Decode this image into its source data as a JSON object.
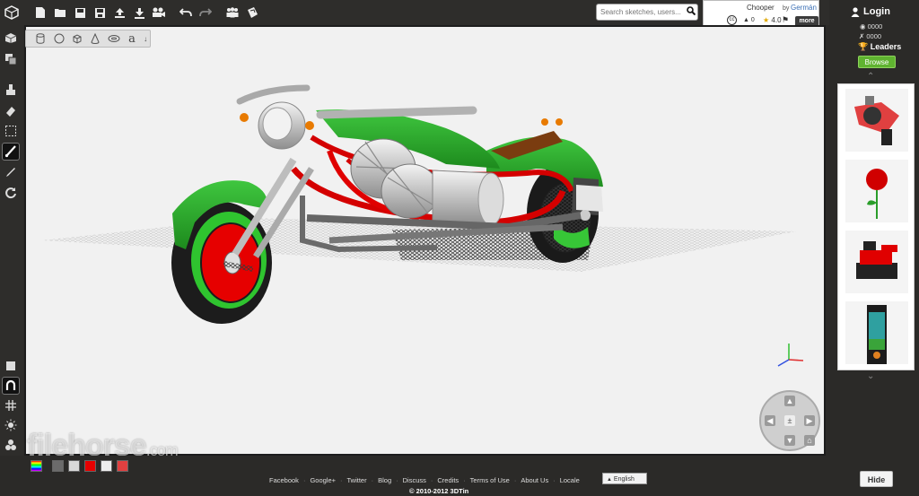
{
  "toolbar": {
    "icons": [
      "new-icon",
      "open-icon",
      "save-icon",
      "save-as-icon",
      "upload-icon",
      "download-icon",
      "camera-icon",
      "undo-icon",
      "redo-icon",
      "community-icon",
      "share-icon"
    ]
  },
  "search": {
    "placeholder": "Search sketches, users..."
  },
  "model_info": {
    "title": "Chooper",
    "by": "by",
    "author": "Germán",
    "cc_label": "cc",
    "stats": "0",
    "rating": "4.0",
    "more_label": "more"
  },
  "shape_tools": [
    "cylinder",
    "sphere",
    "cube",
    "cone",
    "torus",
    "text"
  ],
  "text_tool_glyph": "a",
  "left_tools": [
    "view-cube-icon",
    "box-group-icon",
    "paint-bucket-icon",
    "eraser-icon",
    "select-rect-icon",
    "brush-icon",
    "eyedropper-icon",
    "rotate-icon"
  ],
  "left_tools_bottom": [
    "cube-solid-icon",
    "magnet-icon",
    "grid-icon",
    "sun-icon",
    "settings-icon"
  ],
  "user": {
    "login_label": "Login",
    "count1": "0000",
    "count2": "0000",
    "leaders_label": "Leaders",
    "browse_label": "Browse"
  },
  "gallery": {
    "items": [
      "slingshot-model",
      "rose-model",
      "tank-model",
      "angry-birds-model"
    ]
  },
  "palette": {
    "colors": [
      "#6b6b6b",
      "#d9d9d9",
      "#e60000",
      "#eeeeee",
      "#e04040"
    ]
  },
  "watermark": {
    "brand": "filehorse",
    "tld": ".com"
  },
  "footer": {
    "links": [
      "Facebook",
      "Google+",
      "Twitter",
      "Blog",
      "Discuss",
      "Credits",
      "Terms of Use",
      "About Us",
      "Locale"
    ],
    "language": "English",
    "copyright": "© 2010-2012 3DTin",
    "hide_label": "Hide"
  }
}
